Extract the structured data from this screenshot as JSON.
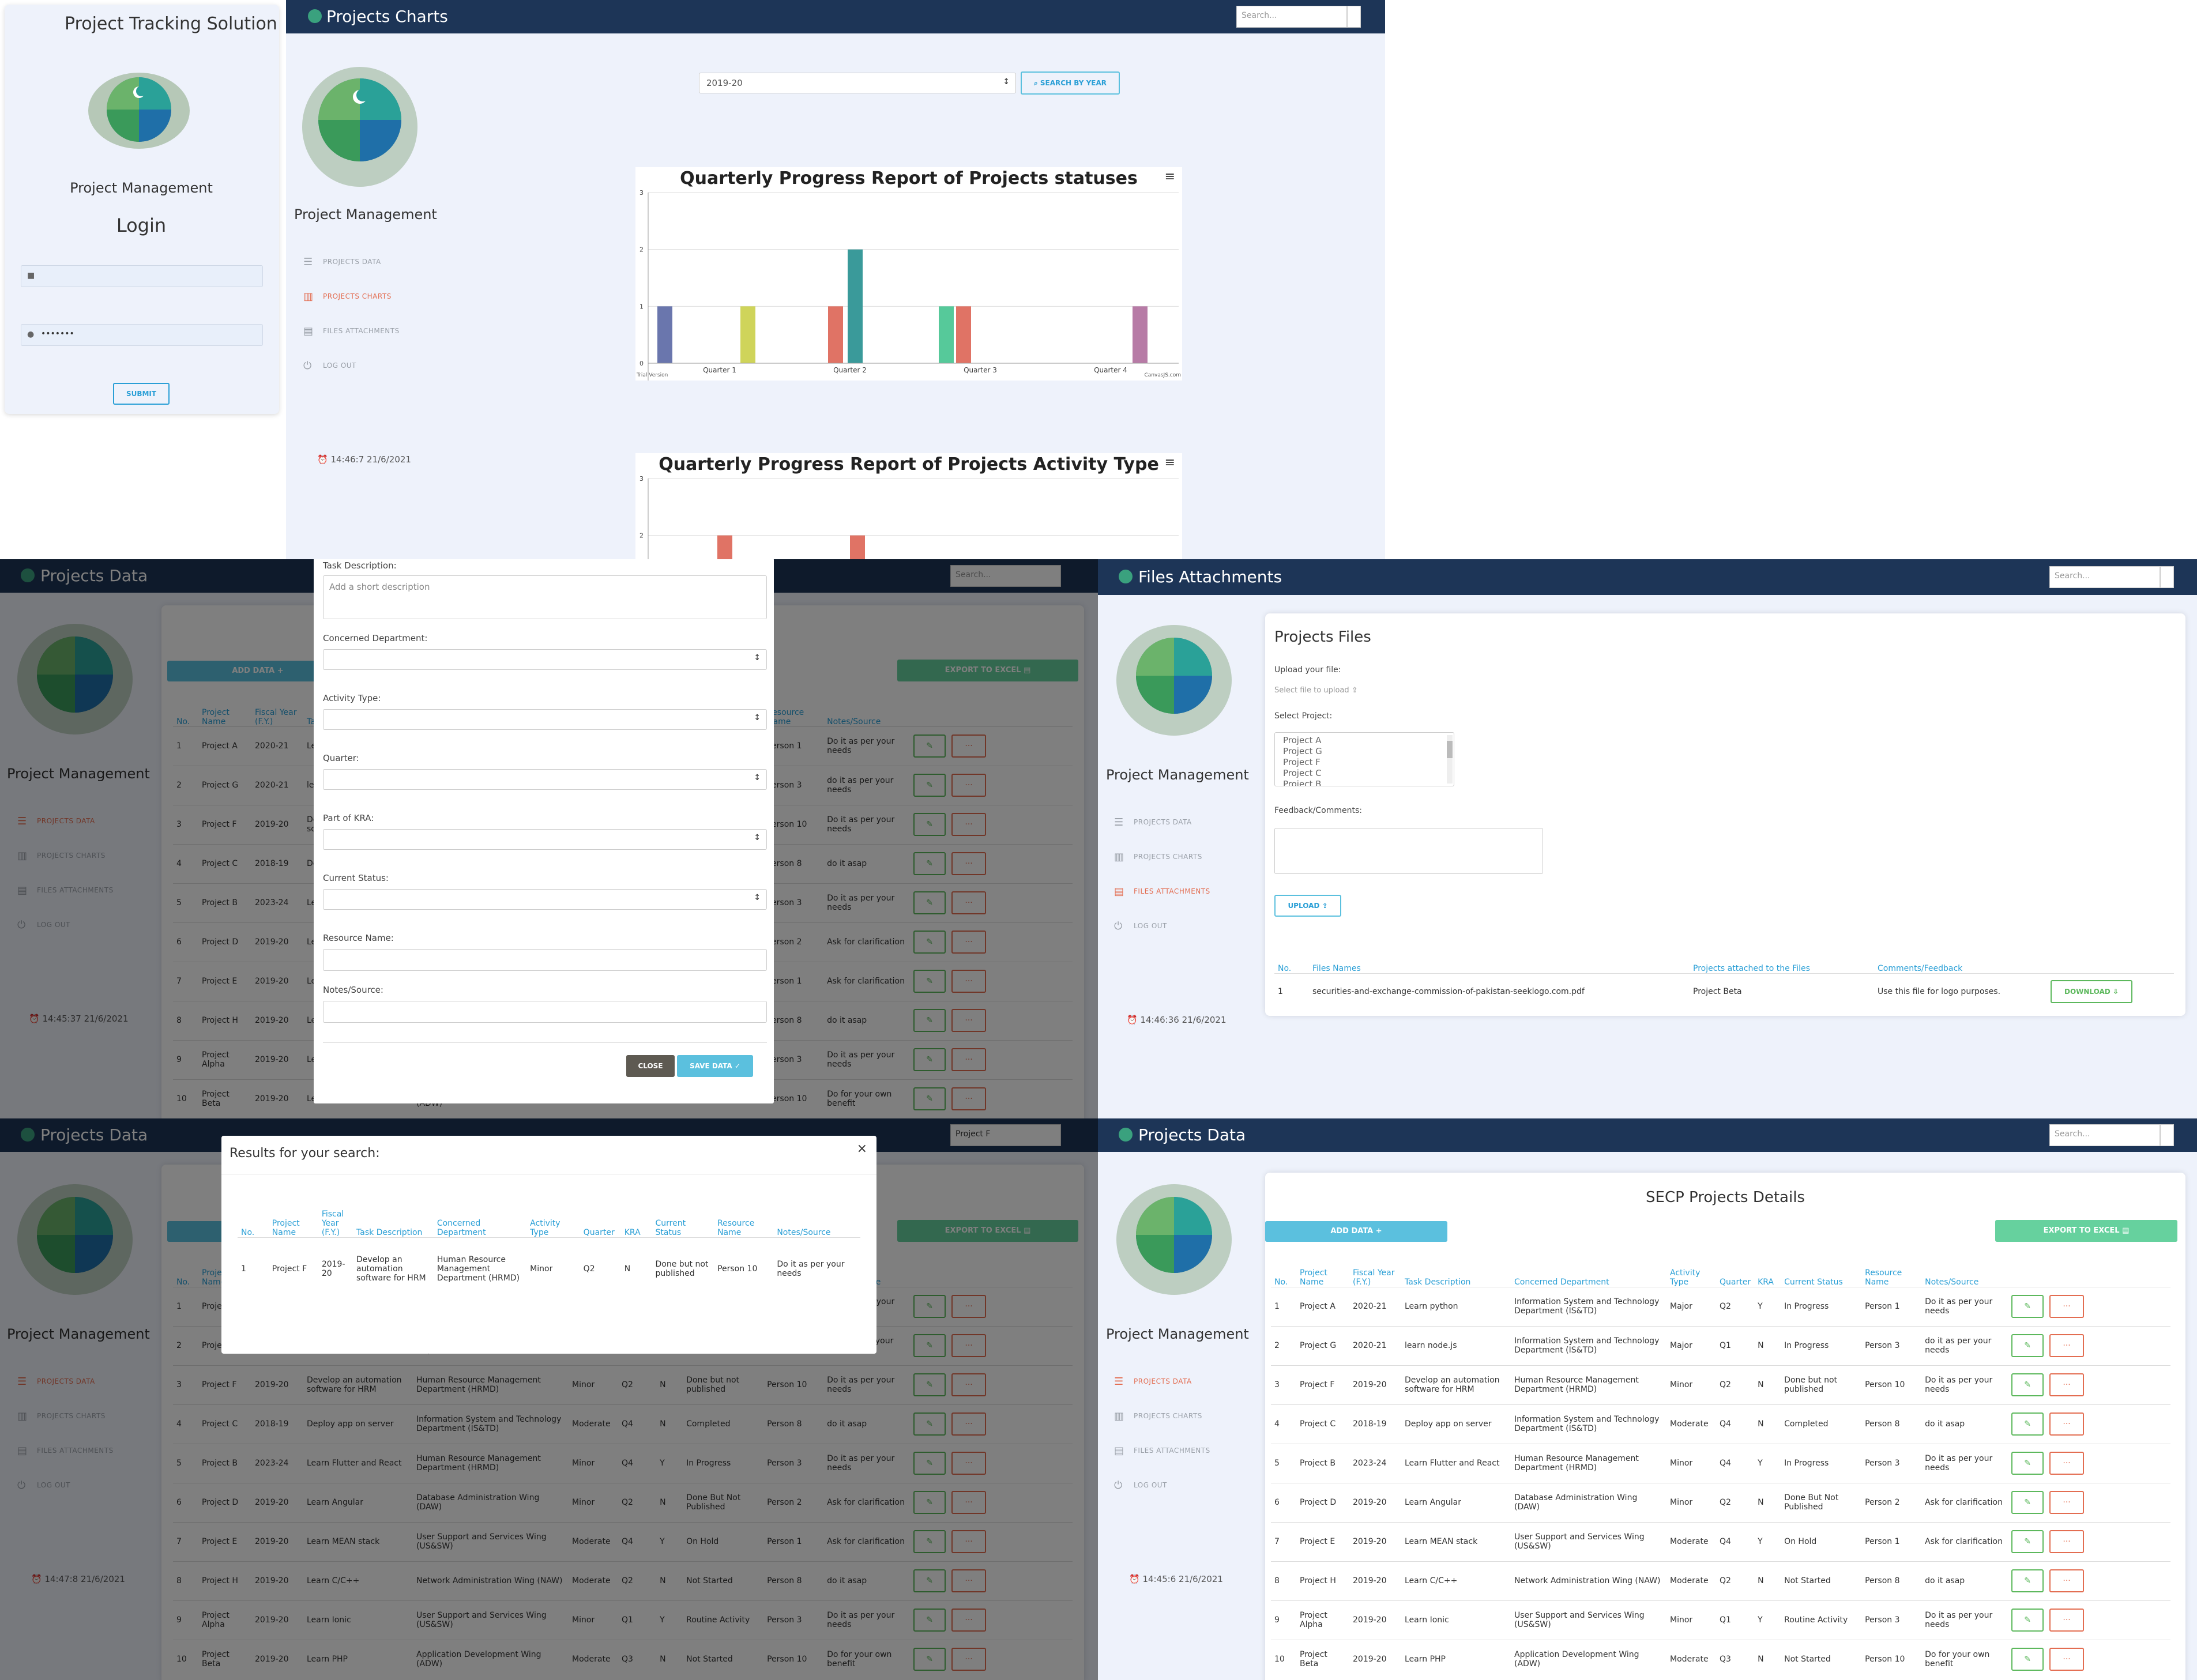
{
  "login": {
    "title": "Project Tracking Solution",
    "subtitle": "Project Management",
    "heading": "Login",
    "password_value": "•••••••",
    "submit_label": "SUBMIT"
  },
  "charts_page": {
    "app_title": "Projects Charts",
    "search_placeholder": "Search...",
    "side_title": "Project Management",
    "nav": [
      "PROJECTS DATA",
      "PROJECTS CHARTS",
      "FILES ATTACHMENTS",
      "LOG OUT"
    ],
    "year_value": "2019-20",
    "search_year_label": "SEARCH BY YEAR",
    "clock": "14:46:7 21/6/2021",
    "credit_left": "Trial Version",
    "credit_right": "CanvasJS.com"
  },
  "chart_data": [
    {
      "type": "bar",
      "title": "Quarterly Progress Report of Projects statuses",
      "categories": [
        "Quarter 1",
        "Quarter 2",
        "Quarter 3",
        "Quarter 4"
      ],
      "ylim": [
        0,
        3
      ],
      "yticks": [
        "0",
        "1",
        "2",
        "3"
      ],
      "bars": [
        {
          "quarter": 1,
          "value": 1,
          "color": "#6a76ad"
        },
        {
          "quarter": 1,
          "value": 1,
          "color": "#cfd45a"
        },
        {
          "quarter": 2,
          "value": 1,
          "color": "#e07365"
        },
        {
          "quarter": 2,
          "value": 2,
          "color": "#3a9a9a"
        },
        {
          "quarter": 3,
          "value": 1,
          "color": "#56c99a"
        },
        {
          "quarter": 3,
          "value": 1,
          "color": "#e07365"
        },
        {
          "quarter": 4,
          "value": 1,
          "color": "#b77ba6"
        }
      ]
    },
    {
      "type": "bar",
      "title": "Quarterly Progress Report of Projects Activity Type",
      "ylim": [
        0,
        3
      ],
      "yticks": [
        "2",
        "3"
      ],
      "bars": [
        {
          "quarter": 1,
          "value": 2,
          "color": "#e07365"
        },
        {
          "quarter": 2,
          "value": 2,
          "color": "#e07365"
        }
      ]
    }
  ],
  "data_modal_page": {
    "app_title": "Projects Data",
    "search_placeholder": "Search...",
    "side_title": "Project Management",
    "nav": [
      "PROJECTS DATA",
      "PROJECTS CHARTS",
      "FILES ATTACHMENTS",
      "LOG OUT"
    ],
    "clock": "14:45:37 21/6/2021",
    "add_label": "ADD DATA",
    "export_label": "EXPORT TO EXCEL",
    "modal": {
      "task_label": "Task Description:",
      "task_placeholder": "Add a short description",
      "dept_label": "Concerned Department:",
      "activity_label": "Activity Type:",
      "quarter_label": "Quarter:",
      "kra_label": "Part of KRA:",
      "status_label": "Current Status:",
      "resource_label": "Resource Name:",
      "notes_label": "Notes/Source:",
      "close_label": "CLOSE",
      "save_label": "SAVE DATA"
    }
  },
  "files_page": {
    "app_title": "Files Attachments",
    "search_placeholder": "Search...",
    "side_title": "Project Management",
    "nav": [
      "PROJECTS DATA",
      "PROJECTS CHARTS",
      "FILES ATTACHMENTS",
      "LOG OUT"
    ],
    "clock": "14:46:36 21/6/2021",
    "card_title": "Projects Files",
    "upload_label": "Upload your file:",
    "select_file": "Select file to upload",
    "select_project_label": "Select Project:",
    "projects_list": [
      "Project A",
      "Project G",
      "Project F",
      "Project C",
      "Project B"
    ],
    "feedback_label": "Feedback/Comments:",
    "upload_button": "UPLOAD",
    "table_headers": [
      "No.",
      "Files Names",
      "Projects attached to the Files",
      "Comments/Feedback"
    ],
    "rows": [
      {
        "no": "1",
        "file": "securities-and-exchange-commission-of-pakistan-seeklogo.com.pdf",
        "project": "Project Beta",
        "comment": "Use this file for logo purposes.",
        "action": "DOWNLOAD"
      }
    ]
  },
  "search_page": {
    "app_title": "Projects Data",
    "search_value": "Project F",
    "side_title": "Project Management",
    "nav": [
      "PROJECTS DATA",
      "PROJECTS CHARTS",
      "FILES ATTACHMENTS",
      "LOG OUT"
    ],
    "clock": "14:47:8 21/6/2021",
    "export_label": "EXPORT TO EXCEL",
    "modal_title": "Results for your search:",
    "close_x": "×",
    "headers": [
      "No.",
      "Project Name",
      "Fiscal Year (F.Y.)",
      "Task Description",
      "Concerned Department",
      "Activity Type",
      "Quarter",
      "KRA",
      "Current Status",
      "Resource Name",
      "Notes/Source"
    ],
    "result": [
      "1",
      "Project F",
      "2019-20",
      "Develop an automation software for HRM",
      "Human Resource Management Department (HRMD)",
      "Minor",
      "Q2",
      "N",
      "Done but not published",
      "Person 10",
      "Do it as per your needs"
    ]
  },
  "details_page": {
    "app_title": "Projects Data",
    "search_placeholder": "Search...",
    "side_title": "Project Management",
    "nav": [
      "PROJECTS DATA",
      "PROJECTS CHARTS",
      "FILES ATTACHMENTS",
      "LOG OUT"
    ],
    "clock": "14:45:6 21/6/2021",
    "card_title": "SECP Projects Details",
    "add_label": "ADD DATA",
    "export_label": "EXPORT TO EXCEL",
    "headers": [
      "No.",
      "Project Name",
      "Fiscal Year (F.Y.)",
      "Task Description",
      "Concerned Department",
      "Activity Type",
      "Quarter",
      "KRA",
      "Current Status",
      "Resource Name",
      "Notes/Source"
    ]
  },
  "projects": [
    [
      "1",
      "Project A",
      "2020-21",
      "Learn python",
      "Information System and Technology Department (IS&TD)",
      "Major",
      "Q2",
      "Y",
      "In Progress",
      "Person 1",
      "Do it as per your needs"
    ],
    [
      "2",
      "Project G",
      "2020-21",
      "learn node.js",
      "Information System and Technology Department (IS&TD)",
      "Major",
      "Q1",
      "N",
      "In Progress",
      "Person 3",
      "do it as per your needs"
    ],
    [
      "3",
      "Project F",
      "2019-20",
      "Develop an automation software for HRM",
      "Human Resource Management Department (HRMD)",
      "Minor",
      "Q2",
      "N",
      "Done but not published",
      "Person 10",
      "Do it as per your needs"
    ],
    [
      "4",
      "Project C",
      "2018-19",
      "Deploy app on server",
      "Information System and Technology Department (IS&TD)",
      "Moderate",
      "Q4",
      "N",
      "Completed",
      "Person 8",
      "do it asap"
    ],
    [
      "5",
      "Project B",
      "2023-24",
      "Learn Flutter and React",
      "Human Resource Management Department (HRMD)",
      "Minor",
      "Q4",
      "Y",
      "In Progress",
      "Person 3",
      "Do it as per your needs"
    ],
    [
      "6",
      "Project D",
      "2019-20",
      "Learn Angular",
      "Database Administration Wing (DAW)",
      "Minor",
      "Q2",
      "N",
      "Done But Not Published",
      "Person 2",
      "Ask for clarification"
    ],
    [
      "7",
      "Project E",
      "2019-20",
      "Learn MEAN stack",
      "User Support and Services Wing (US&SW)",
      "Moderate",
      "Q4",
      "Y",
      "On Hold",
      "Person 1",
      "Ask for clarification"
    ],
    [
      "8",
      "Project H",
      "2019-20",
      "Learn C/C++",
      "Network Administration Wing (NAW)",
      "Moderate",
      "Q2",
      "N",
      "Not Started",
      "Person 8",
      "do it asap"
    ],
    [
      "9",
      "Project Alpha",
      "2019-20",
      "Learn Ionic",
      "User Support and Services Wing (US&SW)",
      "Minor",
      "Q1",
      "Y",
      "Routine Activity",
      "Person 3",
      "Do it as per your needs"
    ],
    [
      "10",
      "Project Beta",
      "2019-20",
      "Learn PHP",
      "Application Development Wing (ADW)",
      "Moderate",
      "Q3",
      "N",
      "Not Started",
      "Person 10",
      "Do for your own benefit"
    ]
  ],
  "colors": {
    "navbar": "#1d3557",
    "accent_blue": "#5bc0de",
    "accent_green": "#66d19e",
    "accent_orange": "#e36d51"
  }
}
